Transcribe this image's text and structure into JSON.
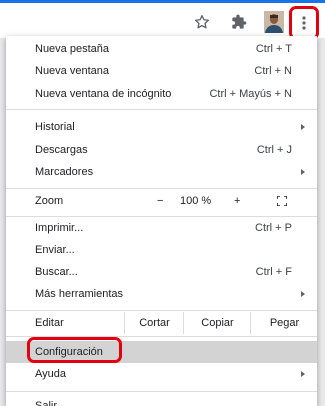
{
  "toolbar": {
    "icons": [
      "star-icon",
      "puzzle-extension-icon",
      "profile-avatar",
      "kebab-menu-icon"
    ],
    "highlight_color": "#e3000f",
    "accent_color": "#1a73e8"
  },
  "menu": {
    "new_tab": {
      "label": "Nueva pestaña",
      "shortcut": "Ctrl + T"
    },
    "new_window": {
      "label": "Nueva ventana",
      "shortcut": "Ctrl + N"
    },
    "incognito": {
      "label": "Nueva ventana de incógnito",
      "shortcut": "Ctrl + Mayús + N"
    },
    "history": {
      "label": "Historial"
    },
    "downloads": {
      "label": "Descargas",
      "shortcut": "Ctrl + J"
    },
    "bookmarks": {
      "label": "Marcadores"
    },
    "zoom": {
      "label": "Zoom",
      "minus": "−",
      "value": "100 %",
      "plus": "+"
    },
    "print": {
      "label": "Imprimir...",
      "shortcut": "Ctrl + P"
    },
    "send": {
      "label": "Enviar..."
    },
    "find": {
      "label": "Buscar...",
      "shortcut": "Ctrl + F"
    },
    "more_tools": {
      "label": "Más herramientas"
    },
    "edit": {
      "label": "Editar",
      "cut": "Cortar",
      "copy": "Copiar",
      "paste": "Pegar"
    },
    "settings": {
      "label": "Configuración"
    },
    "help": {
      "label": "Ayuda"
    },
    "exit": {
      "label": "Salir"
    }
  }
}
